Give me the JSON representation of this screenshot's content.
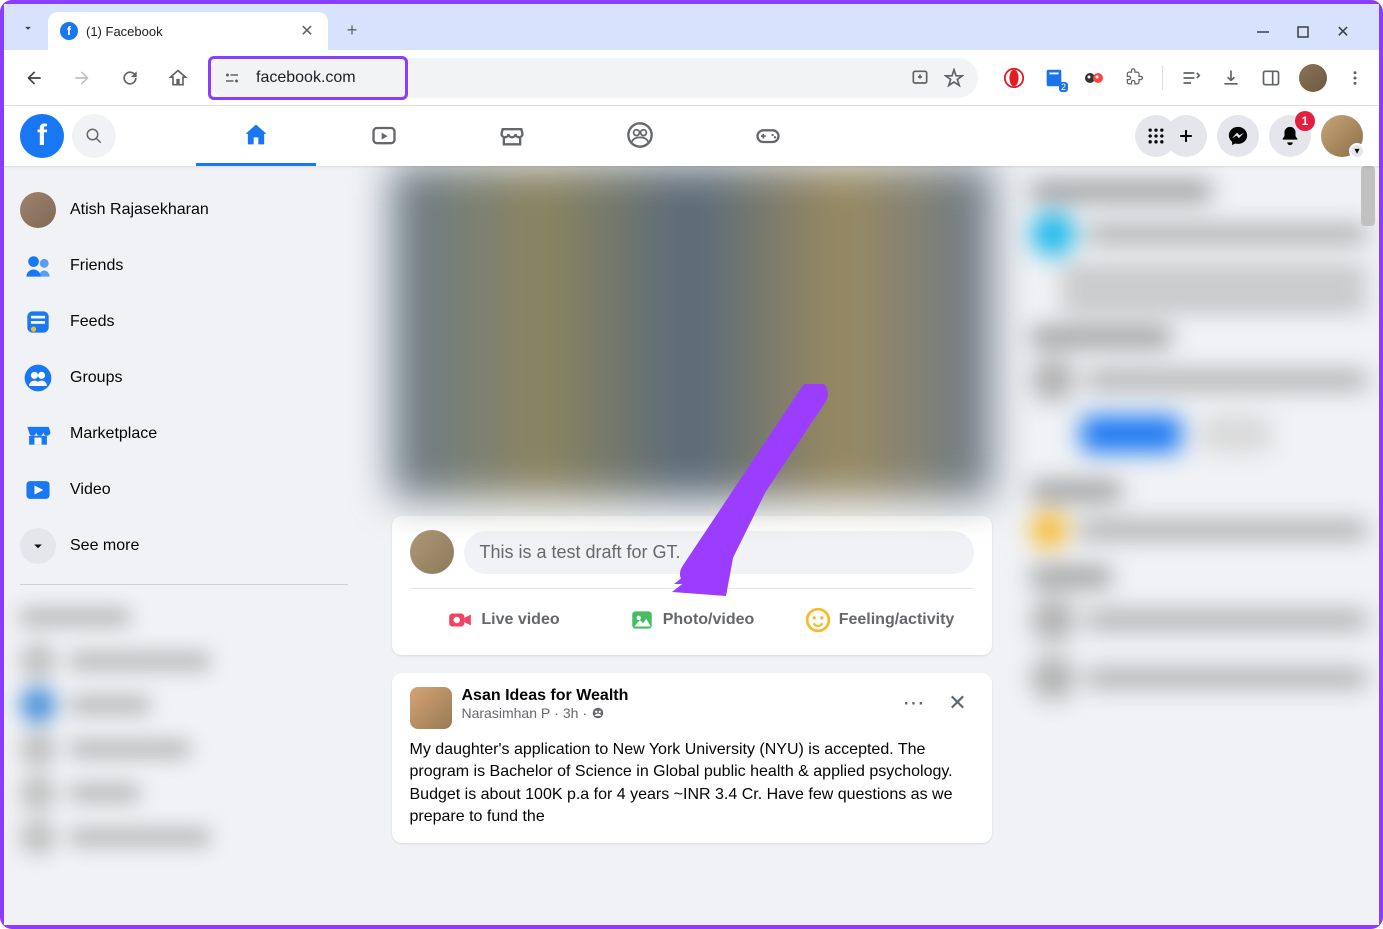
{
  "browser": {
    "tab_title": "(1) Facebook",
    "url": "facebook.com",
    "extension_badge": "2"
  },
  "fb_header": {
    "notification_count": "1"
  },
  "sidebar": {
    "items": [
      {
        "label": "Atish Rajasekharan",
        "icon": "avatar"
      },
      {
        "label": "Friends",
        "icon": "friends"
      },
      {
        "label": "Feeds",
        "icon": "feeds"
      },
      {
        "label": "Groups",
        "icon": "groups"
      },
      {
        "label": "Marketplace",
        "icon": "marketplace"
      },
      {
        "label": "Video",
        "icon": "video"
      },
      {
        "label": "See more",
        "icon": "more"
      }
    ]
  },
  "composer": {
    "placeholder": "This is a test draft for GT.",
    "actions": {
      "live": "Live video",
      "photo": "Photo/video",
      "feeling": "Feeling/activity"
    }
  },
  "post": {
    "page_name": "Asan Ideas for Wealth",
    "author": "Narasimhan P",
    "time": "3h",
    "body": "My daughter's application to New York University (NYU)  is accepted. The program is Bachelor of Science in Global public health & applied psychology. Budget is about 100K p.a for 4 years ~INR 3.4 Cr. Have few questions as we prepare to fund the"
  }
}
